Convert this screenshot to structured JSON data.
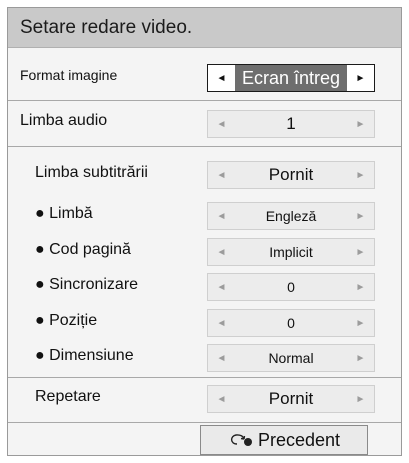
{
  "title": "Setare redare video.",
  "rows": {
    "format": {
      "label": "Format imagine",
      "value": "Ecran întreg"
    },
    "audio": {
      "label": "Limba audio",
      "value": "1"
    },
    "subtitles": {
      "label": "Limba subtitrării",
      "value": "Pornit"
    },
    "language": {
      "label": "● Limbă",
      "value": "Engleză"
    },
    "codepage": {
      "label": "● Cod pagină",
      "value": "Implicit"
    },
    "sync": {
      "label": "● Sincronizare",
      "value": "0"
    },
    "position": {
      "label": "● Poziție",
      "value": "0"
    },
    "size": {
      "label": "● Dimensiune",
      "value": "Normal"
    },
    "repeat": {
      "label": "Repetare",
      "value": "Pornit"
    }
  },
  "arrows": {
    "left": "◄",
    "right": "►"
  },
  "back_button": {
    "label": "Precedent",
    "icon": "return-arrow-icon"
  },
  "colors": {
    "title_bg": "#c9c9c9",
    "active_value_bg": "#6e6e6e"
  }
}
